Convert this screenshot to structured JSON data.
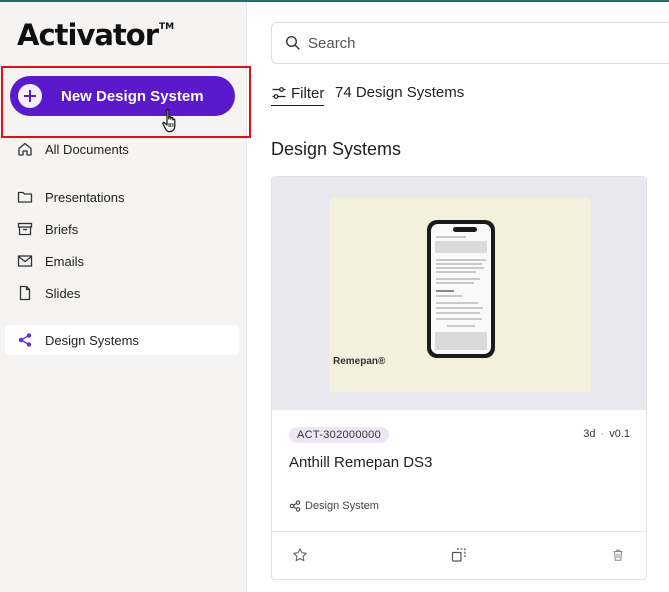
{
  "app": {
    "logo_text": "Activator",
    "logo_mark": "TM"
  },
  "sidebar": {
    "new_button_label": "New Design System",
    "items": [
      {
        "label": "All Documents",
        "icon": "home-icon"
      },
      {
        "label": "Presentations",
        "icon": "folder-icon"
      },
      {
        "label": "Briefs",
        "icon": "archive-icon"
      },
      {
        "label": "Emails",
        "icon": "mail-icon"
      },
      {
        "label": "Slides",
        "icon": "file-icon"
      },
      {
        "label": "Design Systems",
        "icon": "share-icon",
        "active": true
      }
    ]
  },
  "search": {
    "placeholder": "Search"
  },
  "toolbar": {
    "filter_label": "Filter",
    "count_text": "74 Design Systems"
  },
  "section": {
    "title": "Design Systems"
  },
  "cards": [
    {
      "thumbnail_brand": "Remepan®",
      "tag": "ACT-302000000",
      "age": "3d",
      "version": "v0.1",
      "title": "Anthill Remepan DS3",
      "type": "Design System"
    }
  ],
  "colors": {
    "accent": "#5a1acc",
    "highlight": "#e0101a",
    "tag_bg": "#eee6f4",
    "top_line": "#1f6e6a"
  }
}
